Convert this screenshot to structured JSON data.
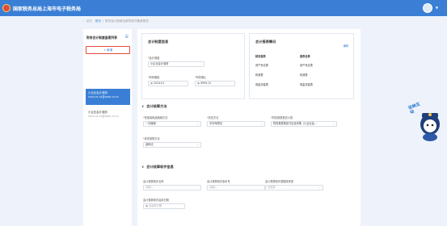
{
  "header": {
    "title": "国家税务总局上海市电子税务局"
  },
  "breadcrumb": {
    "back": "返回",
    "home": "首页",
    "current": "财务会计制度及核算软件备案报告"
  },
  "sidebar": {
    "title": "财务会计制度备案列表",
    "add": "+ 新增",
    "items": [
      {
        "name": "小企业会计准则",
        "date": "2024-01-01至9999-12-31"
      },
      {
        "name": "小企业会计准则",
        "date": "2024-01-01至9999-12-31"
      }
    ]
  },
  "card_rules": {
    "title": "会计制度信息",
    "field_standard_label": "会计制度",
    "field_standard_value": "小企业会计准则",
    "start_label": "有效期起",
    "start_value": "2024-01",
    "end_label": "有效期止",
    "end_value": "9999-12"
  },
  "card_report": {
    "title": "会计报表情况",
    "link": "编辑",
    "items": [
      "财务报表",
      "报表名称",
      "资产负债表",
      "资产负债表",
      "利润表",
      "利润表",
      "现金流量表",
      "现金流量表"
    ]
  },
  "section_method": {
    "title": "会计核算方法",
    "f1_label": "低值易耗品摊销方法",
    "f1_value": "一次摊销",
    "f2_label": "折旧方法",
    "f2_value": "平均年限法",
    "f3_label": "财务报表报送小类",
    "f3_value": "财务报表报送与信息采集（小企业会...",
    "f4_label": "成本核算方法",
    "f4_value": "品种法"
  },
  "section_software": {
    "title": "会计核算软件信息",
    "f1_label": "会计核算软件名称",
    "f1_ph": "请输入",
    "f2_label": "会计核算软件版本号",
    "f2_ph": "请输入",
    "f3_label": "会计核算软件数据库类型",
    "f3_ph": "请选择",
    "f4_label": "会计核算软件启用日期",
    "f4_ph": "请选择日期"
  },
  "mascot": {
    "text": "征纳互动"
  }
}
